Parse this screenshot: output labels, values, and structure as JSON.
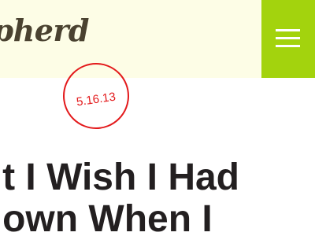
{
  "header": {
    "site_title": "epherd",
    "menu_icon": "hamburger-menu-icon",
    "background_color": "#fdfde6",
    "menu_button_color": "#a3d30d"
  },
  "post": {
    "date": "5.16.13",
    "title_lines": [
      "t I Wish I Had",
      "own When I"
    ],
    "stamp_color": "#e3191b"
  }
}
